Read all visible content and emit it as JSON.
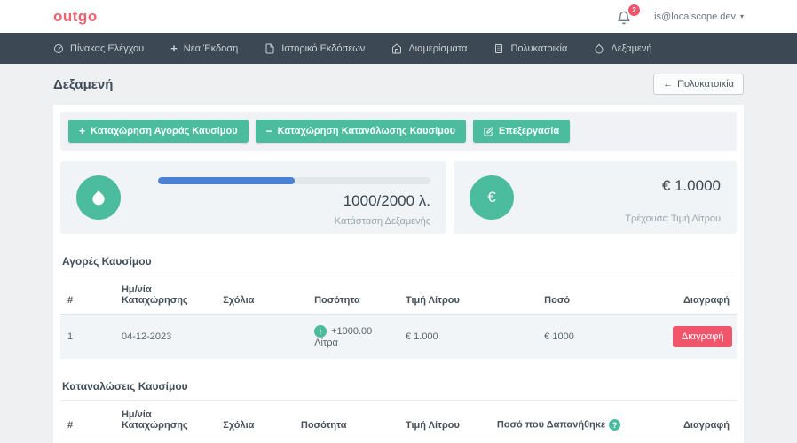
{
  "header": {
    "logo": "outgo",
    "notifications_badge": "2",
    "user_email": "is@localscope.dev"
  },
  "navbar": {
    "items": [
      {
        "label": "Πίνακας Ελέγχου",
        "icon": "dashboard-icon"
      },
      {
        "label": "Νέα Έκδοση",
        "icon": "plus-icon"
      },
      {
        "label": "Ιστορικό Εκδόσεων",
        "icon": "file-icon"
      },
      {
        "label": "Διαμερίσματα",
        "icon": "home-icon"
      },
      {
        "label": "Πολυκατοικία",
        "icon": "building-icon"
      },
      {
        "label": "Δεξαμενή",
        "icon": "droplet-icon"
      }
    ]
  },
  "page": {
    "title": "Δεξαμενή",
    "back_button": {
      "icon": "←",
      "label": "Πολυκατοικία"
    }
  },
  "actions": {
    "add_purchase": {
      "icon": "+",
      "label": "Καταχώρηση Αγοράς Καυσίμου"
    },
    "add_consumption": {
      "icon": "−",
      "label": "Καταχώρηση Κατανάλωσης Καυσίμου"
    },
    "edit": {
      "label": "Επεξεργασία"
    }
  },
  "tank_card": {
    "value": "1000/2000 λ.",
    "caption": "Κατάσταση Δεξαμενής",
    "progress_percent": 50
  },
  "price_card": {
    "icon": "€",
    "value": "€ 1.0000",
    "caption": "Τρέχουσα Τιμή Λίτρου"
  },
  "purchases": {
    "title": "Αγορές Καυσίμου",
    "columns": [
      "#",
      "Ημ/νία Καταχώρησης",
      "Σχόλια",
      "Ποσότητα",
      "Τιμή Λίτρου",
      "Ποσό",
      "Διαγραφή"
    ],
    "rows": [
      {
        "index": "1",
        "date": "04-12-2023",
        "comments": "",
        "quantity_icon": "↑",
        "quantity": "+1000.00 Λίτρα",
        "price_per_liter": "€ 1.000",
        "amount": "€ 1000",
        "delete_label": "Διαγραφή"
      }
    ]
  },
  "consumptions": {
    "title": "Καταναλώσεις Καυσίμου",
    "columns": [
      "#",
      "Ημ/νία Καταχώρησης",
      "Σχόλια",
      "Ποσότητα",
      "Τιμή Λίτρου",
      "Ποσό που Δαπανήθηκε",
      "Διαγραφή"
    ],
    "help_icon": "?",
    "rows": []
  },
  "colors": {
    "accent_green": "#4bbc9d",
    "danger_red": "#f1556c",
    "progress_blue": "#4a81d4",
    "navbar_bg": "#3c4853",
    "logo_red": "#f0616e"
  }
}
